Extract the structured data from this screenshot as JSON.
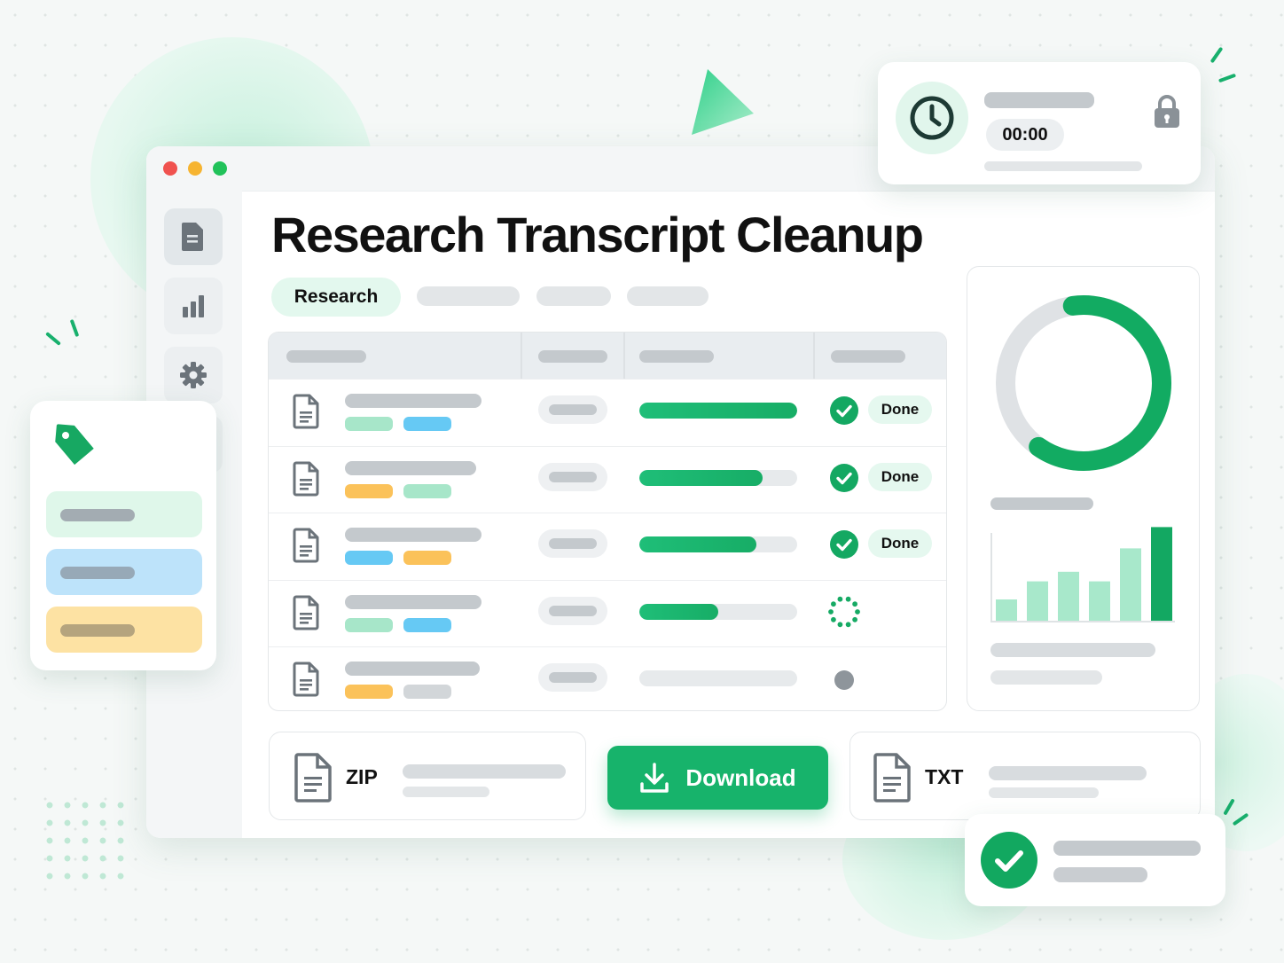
{
  "app": {
    "title": "Research Transcript Cleanup",
    "active_tag": "Research"
  },
  "colors": {
    "accent": "#17b36b",
    "accent_light": "#e3f8ee",
    "blue": "#66c9f4",
    "yellow": "#fbc25a",
    "mint": "#a7e6c9"
  },
  "sidebar": {
    "items": [
      {
        "icon": "document-icon",
        "active": true
      },
      {
        "icon": "bar-chart-icon",
        "active": false
      },
      {
        "icon": "gear-icon",
        "active": false
      },
      {
        "icon": "users-icon",
        "active": false
      }
    ]
  },
  "timer": {
    "value": "00:00",
    "icons": [
      "clock-icon",
      "lock-icon"
    ]
  },
  "table": {
    "rows": [
      {
        "progress": 1.0,
        "status": "done",
        "status_label": "Done",
        "tags": [
          "mint",
          "blue"
        ]
      },
      {
        "progress": 0.78,
        "status": "done",
        "status_label": "Done",
        "tags": [
          "yellow",
          "mint"
        ]
      },
      {
        "progress": 0.74,
        "status": "done",
        "status_label": "Done",
        "tags": [
          "blue",
          "yellow"
        ]
      },
      {
        "progress": 0.5,
        "status": "processing",
        "tags": [
          "mint",
          "blue"
        ]
      },
      {
        "progress": 0.0,
        "status": "pending",
        "tags": [
          "yellow",
          "gray"
        ]
      }
    ]
  },
  "stats": {
    "donut_fraction": 0.62,
    "bars": [
      0.2,
      0.37,
      0.46,
      0.37,
      0.68,
      0.88
    ]
  },
  "export": {
    "zip_label": "ZIP",
    "download_label": "Download",
    "txt_label": "TXT"
  }
}
